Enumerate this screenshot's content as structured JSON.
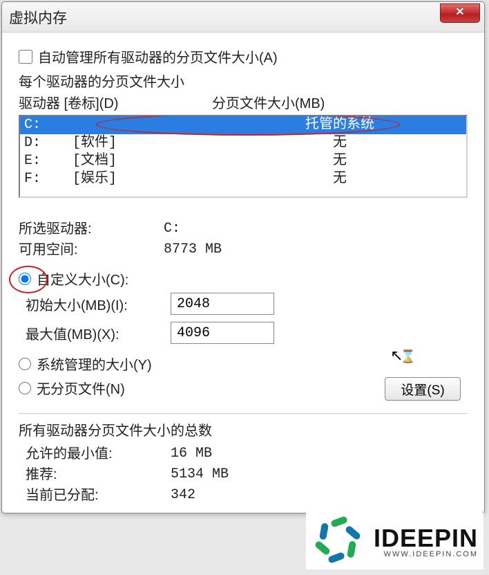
{
  "window": {
    "title": "虚拟内存",
    "close": "✕"
  },
  "autoManage": {
    "label": "自动管理所有驱动器的分页文件大小(A)",
    "checked": false
  },
  "driveSection": {
    "heading": "每个驱动器的分页文件大小",
    "colDrive": "驱动器 [卷标](D)",
    "colSize": "分页文件大小(MB)"
  },
  "drives": [
    {
      "letter": "C:",
      "label": "",
      "size": "托管的系统",
      "selected": true
    },
    {
      "letter": "D:",
      "label": "[软件]",
      "size": "无",
      "selected": false
    },
    {
      "letter": "E:",
      "label": "[文档]",
      "size": "无",
      "selected": false
    },
    {
      "letter": "F:",
      "label": "[娱乐]",
      "size": "无",
      "selected": false
    }
  ],
  "selectedDrive": {
    "driveLabel": "所选驱动器:",
    "driveValue": "C:",
    "freeLabel": "可用空间:",
    "freeValue": "8773 MB"
  },
  "options": {
    "custom": "自定义大小(C):",
    "initLabel": "初始大小(MB)(I):",
    "initValue": "2048",
    "maxLabel": "最大值(MB)(X):",
    "maxValue": "4096",
    "system": "系统管理的大小(Y)",
    "none": "无分页文件(N)",
    "setBtn": "设置(S)",
    "selected": "custom"
  },
  "totals": {
    "heading": "所有驱动器分页文件大小的总数",
    "minLabel": "允许的最小值:",
    "minValue": "16 MB",
    "recLabel": "推荐:",
    "recValue": "5134 MB",
    "curLabel": "当前已分配:",
    "curValue": "342"
  },
  "watermark": {
    "text": "IDEEPIN",
    "sub": "WWW.IDEEPIN.COM"
  }
}
